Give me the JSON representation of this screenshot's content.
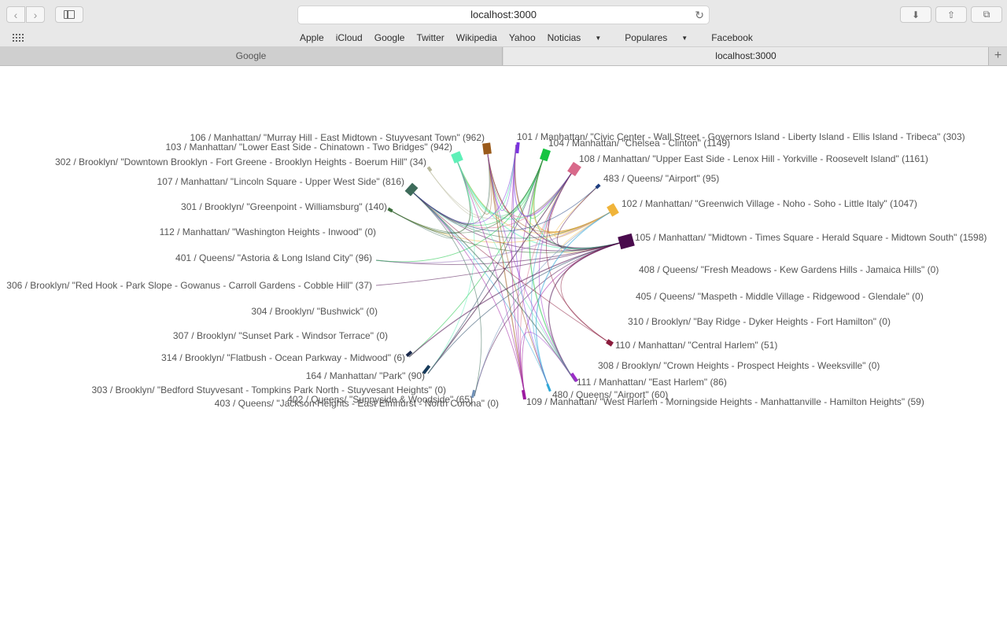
{
  "toolbar": {
    "back_icon": "chevron-left-icon",
    "forward_icon": "chevron-right-icon",
    "url": "localhost:3000",
    "reload_icon": "reload-icon",
    "download_icon": "download-icon",
    "share_icon": "share-icon",
    "tabs_icon": "tabs-overview-icon"
  },
  "favorites": [
    "Apple",
    "iCloud",
    "Google",
    "Twitter",
    "Wikipedia",
    "Yahoo",
    "Noticias",
    "Populares",
    "Facebook"
  ],
  "tabs": [
    {
      "label": "Google",
      "active": false
    },
    {
      "label": "localhost:3000",
      "active": true
    }
  ],
  "chart_data": {
    "type": "chord",
    "title": "",
    "groups": [
      {
        "id": "g101",
        "label": "101 / Manhattan/ \"Civic Center - Wall Street - Governors Island - Liberty Island - Ellis Island - Tribeca\" (303)",
        "color": "#7a33e0"
      },
      {
        "id": "g104",
        "label": "104 / Manhattan/ \"Chelsea - Clinton\" (1149)",
        "color": "#16c442"
      },
      {
        "id": "g108",
        "label": "108 / Manhattan/ \"Upper East Side - Lenox Hill - Yorkville - Roosevelt Island\" (1161)",
        "color": "#d8698a"
      },
      {
        "id": "g483",
        "label": "483 / Queens/ \"Airport\" (95)",
        "color": "#1f3f80"
      },
      {
        "id": "g102",
        "label": "102 / Manhattan/ \"Greenwich Village - Noho - Soho - Little Italy\" (1047)",
        "color": "#f0b43a"
      },
      {
        "id": "g105",
        "label": "105 / Manhattan/ \"Midtown - Times Square - Herald Square - Midtown South\" (1598)",
        "color": "#4a0b4d"
      },
      {
        "id": "g408",
        "label": "408 / Queens/ \"Fresh Meadows - Kew Gardens Hills - Jamaica Hills\" (0)",
        "color": "#999999"
      },
      {
        "id": "g405",
        "label": "405 / Queens/ \"Maspeth - Middle Village - Ridgewood - Glendale\" (0)",
        "color": "#999999"
      },
      {
        "id": "g310",
        "label": "310 / Brooklyn/ \"Bay Ridge - Dyker Heights - Fort Hamilton\" (0)",
        "color": "#999999"
      },
      {
        "id": "g110",
        "label": "110 / Manhattan/ \"Central Harlem\" (51)",
        "color": "#8a1b3c"
      },
      {
        "id": "g308",
        "label": "308 / Brooklyn/ \"Crown Heights - Prospect Heights - Weeksville\" (0)",
        "color": "#999999"
      },
      {
        "id": "g111",
        "label": "111 / Manhattan/ \"East Harlem\" (86)",
        "color": "#9b2fc7"
      },
      {
        "id": "g480",
        "label": "480 / Queens/ \"Airport\" (60)",
        "color": "#2fa7d8"
      },
      {
        "id": "g109",
        "label": "109 / Manhattan/ \"West Harlem - Morningside Heights - Manhattanville - Hamilton Heights\" (59)",
        "color": "#9c1aa0"
      },
      {
        "id": "g403",
        "label": "403 / Queens/ \"Jackson Heights - East Elmhurst - North Corona\" (0)",
        "color": "#999999"
      },
      {
        "id": "g402",
        "label": "402 / Queens/ \"Sunnyside & Woodside\" (65)",
        "color": "#6f90b8"
      },
      {
        "id": "g303",
        "label": "303 / Brooklyn/ \"Bedford Stuyvesant - Tompkins Park North - Stuyvesant Heights\" (0)",
        "color": "#999999"
      },
      {
        "id": "g164",
        "label": "164 / Manhattan/ \"Park\" (90)",
        "color": "#163a5a"
      },
      {
        "id": "g314",
        "label": "314 / Brooklyn/ \"Flatbush - Ocean Parkway - Midwood\" (6)",
        "color": "#1c2a4d"
      },
      {
        "id": "g307",
        "label": "307 / Brooklyn/ \"Sunset Park - Windsor Terrace\" (0)",
        "color": "#999999"
      },
      {
        "id": "g304",
        "label": "304 / Brooklyn/ \"Bushwick\" (0)",
        "color": "#999999"
      },
      {
        "id": "g306",
        "label": "306 / Brooklyn/ \"Red Hook - Park Slope - Gowanus - Carroll Gardens - Cobble Hill\" (37)",
        "color": "#c8b8d8"
      },
      {
        "id": "g401",
        "label": "401 / Queens/ \"Astoria & Long Island City\" (96)",
        "color": "#a98bc7"
      },
      {
        "id": "g112",
        "label": "112 / Manhattan/ \"Washington Heights - Inwood\" (0)",
        "color": "#999999"
      },
      {
        "id": "g301",
        "label": "301 / Brooklyn/ \"Greenpoint - Williamsburg\" (140)",
        "color": "#3b6e3b"
      },
      {
        "id": "g107",
        "label": "107 / Manhattan/ \"Lincoln Square - Upper West Side\" (816)",
        "color": "#3d6b5a"
      },
      {
        "id": "g302",
        "label": "302 / Brooklyn/ \"Downtown Brooklyn - Fort Greene - Brooklyn Heights - Boerum Hill\" (34)",
        "color": "#b8b89a"
      },
      {
        "id": "g103",
        "label": "103 / Manhattan/ \"Lower East Side - Chinatown - Two Bridges\" (942)",
        "color": "#5ff0b8"
      },
      {
        "id": "g106",
        "label": "106 / Manhattan/ \"Murray Hill - East Midtown - Stuyvesant Town\" (962)",
        "color": "#9a5a1a"
      }
    ]
  }
}
